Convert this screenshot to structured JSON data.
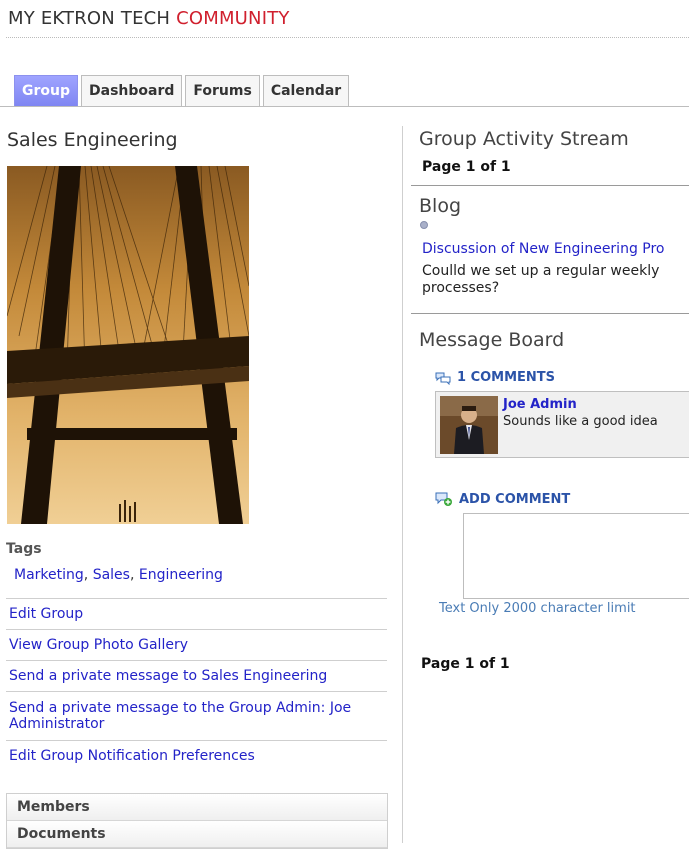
{
  "site": {
    "title_main": "MY EKTRON TECH ",
    "title_accent": "COMMUNITY"
  },
  "tabs": [
    {
      "label": "Group",
      "active": true
    },
    {
      "label": "Dashboard"
    },
    {
      "label": "Forums"
    },
    {
      "label": "Calendar"
    }
  ],
  "group": {
    "name": "Sales Engineering",
    "tags_heading": "Tags",
    "tags": [
      "Marketing",
      "Sales",
      "Engineering"
    ],
    "tag_separator": ", ",
    "links": [
      "Edit Group",
      "View Group Photo Gallery",
      "Send a private message to Sales Engineering",
      "Send a private message to the Group Admin: Joe Administrator",
      "Edit Group Notification Preferences"
    ],
    "sections": [
      "Members",
      "Documents"
    ]
  },
  "activity": {
    "heading": "Group Activity Stream",
    "page_top": "Page 1 of 1",
    "blog_heading": "Blog",
    "blog_post_title": "Discussion of New Engineering Pro",
    "blog_post_excerpt": "Coulld we set up a regular weekly processes?",
    "board_heading": "Message Board",
    "comments_count": "1 COMMENTS",
    "comment": {
      "author": "Joe Admin",
      "text": "Sounds like a good idea"
    },
    "add_comment_label": "ADD COMMENT",
    "comment_placeholder": "",
    "char_limit": "Text Only 2000 character limit",
    "page_bottom": "Page 1 of 1"
  },
  "colors": {
    "accent": "#d0202e",
    "link": "#2323c8",
    "tab_active": "#8c91ee"
  }
}
